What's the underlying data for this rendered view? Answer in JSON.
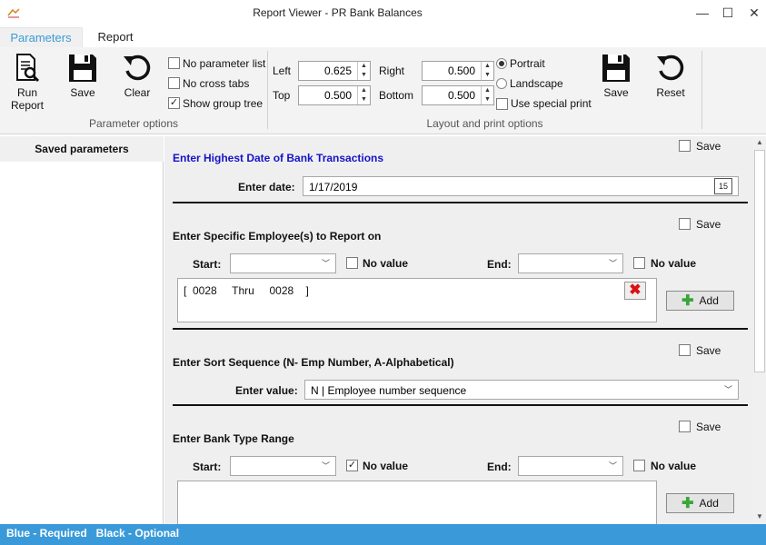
{
  "window": {
    "title": "Report Viewer - PR Bank Balances",
    "minimize_glyph": "—",
    "maximize_glyph": "☐",
    "close_glyph": "✕"
  },
  "tabs": [
    {
      "label": "Parameters",
      "active": true
    },
    {
      "label": "Report",
      "active": false
    }
  ],
  "ribbon": {
    "parameter_options": {
      "group_label": "Parameter options",
      "run_report_label": "Run\nReport",
      "save_label": "Save",
      "clear_label": "Clear",
      "checkboxes": [
        {
          "label": "No parameter list",
          "checked": false
        },
        {
          "label": "No cross tabs",
          "checked": false
        },
        {
          "label": "Show group tree",
          "checked": true
        }
      ]
    },
    "layout_options": {
      "group_label": "Layout and print options",
      "left_label": "Left",
      "left_value": "0.625",
      "top_label": "Top",
      "top_value": "0.500",
      "right_label": "Right",
      "right_value": "0.500",
      "bottom_label": "Bottom",
      "bottom_value": "0.500",
      "portrait_label": "Portrait",
      "landscape_label": "Landscape",
      "orientation": "Portrait",
      "special_print_label": "Use special print",
      "special_print_checked": false,
      "save_label": "Save",
      "reset_label": "Reset"
    }
  },
  "saved_parameters": {
    "header": "Saved parameters"
  },
  "sections": {
    "date": {
      "heading": "Enter Highest Date of Bank Transactions",
      "save_label": "Save",
      "field_label": "Enter date:",
      "value": "1/17/2019",
      "calendar_day": "15"
    },
    "employee": {
      "heading": "Enter Specific Employee(s) to Report on",
      "save_label": "Save",
      "start_label": "Start:",
      "end_label": "End:",
      "no_value_label": "No value",
      "start_no_value": false,
      "end_no_value": false,
      "range_item": "[  0028     Thru     0028    ]",
      "add_label": "Add"
    },
    "sort": {
      "heading": "Enter Sort Sequence (N- Emp Number, A-Alphabetical)",
      "save_label": "Save",
      "field_label": "Enter value:",
      "value": "N | Employee number sequence"
    },
    "bank": {
      "heading": "Enter Bank Type Range",
      "save_label": "Save",
      "start_label": "Start:",
      "end_label": "End:",
      "no_value_label": "No value",
      "start_no_value": true,
      "end_no_value": false,
      "add_label": "Add"
    }
  },
  "status": {
    "text": "Blue - Required   Black - Optional"
  },
  "colors": {
    "required": "#1414c8",
    "accent": "#3a9ad9"
  }
}
